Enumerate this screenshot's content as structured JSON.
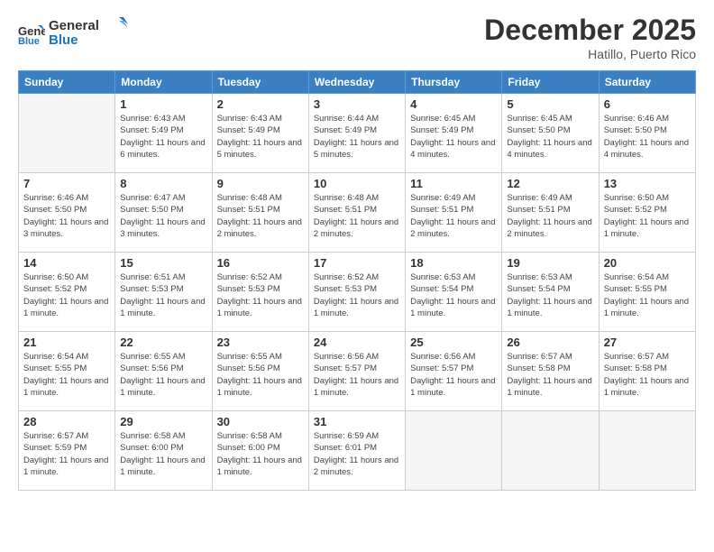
{
  "header": {
    "logo_line1": "General",
    "logo_line2": "Blue",
    "month_title": "December 2025",
    "location": "Hatillo, Puerto Rico"
  },
  "days_of_week": [
    "Sunday",
    "Monday",
    "Tuesday",
    "Wednesday",
    "Thursday",
    "Friday",
    "Saturday"
  ],
  "weeks": [
    [
      {
        "day": "",
        "info": ""
      },
      {
        "day": "1",
        "info": "Sunrise: 6:43 AM\nSunset: 5:49 PM\nDaylight: 11 hours\nand 6 minutes."
      },
      {
        "day": "2",
        "info": "Sunrise: 6:43 AM\nSunset: 5:49 PM\nDaylight: 11 hours\nand 5 minutes."
      },
      {
        "day": "3",
        "info": "Sunrise: 6:44 AM\nSunset: 5:49 PM\nDaylight: 11 hours\nand 5 minutes."
      },
      {
        "day": "4",
        "info": "Sunrise: 6:45 AM\nSunset: 5:49 PM\nDaylight: 11 hours\nand 4 minutes."
      },
      {
        "day": "5",
        "info": "Sunrise: 6:45 AM\nSunset: 5:50 PM\nDaylight: 11 hours\nand 4 minutes."
      },
      {
        "day": "6",
        "info": "Sunrise: 6:46 AM\nSunset: 5:50 PM\nDaylight: 11 hours\nand 4 minutes."
      }
    ],
    [
      {
        "day": "7",
        "info": "Sunrise: 6:46 AM\nSunset: 5:50 PM\nDaylight: 11 hours\nand 3 minutes."
      },
      {
        "day": "8",
        "info": "Sunrise: 6:47 AM\nSunset: 5:50 PM\nDaylight: 11 hours\nand 3 minutes."
      },
      {
        "day": "9",
        "info": "Sunrise: 6:48 AM\nSunset: 5:51 PM\nDaylight: 11 hours\nand 2 minutes."
      },
      {
        "day": "10",
        "info": "Sunrise: 6:48 AM\nSunset: 5:51 PM\nDaylight: 11 hours\nand 2 minutes."
      },
      {
        "day": "11",
        "info": "Sunrise: 6:49 AM\nSunset: 5:51 PM\nDaylight: 11 hours\nand 2 minutes."
      },
      {
        "day": "12",
        "info": "Sunrise: 6:49 AM\nSunset: 5:51 PM\nDaylight: 11 hours\nand 2 minutes."
      },
      {
        "day": "13",
        "info": "Sunrise: 6:50 AM\nSunset: 5:52 PM\nDaylight: 11 hours\nand 1 minute."
      }
    ],
    [
      {
        "day": "14",
        "info": "Sunrise: 6:50 AM\nSunset: 5:52 PM\nDaylight: 11 hours\nand 1 minute."
      },
      {
        "day": "15",
        "info": "Sunrise: 6:51 AM\nSunset: 5:53 PM\nDaylight: 11 hours\nand 1 minute."
      },
      {
        "day": "16",
        "info": "Sunrise: 6:52 AM\nSunset: 5:53 PM\nDaylight: 11 hours\nand 1 minute."
      },
      {
        "day": "17",
        "info": "Sunrise: 6:52 AM\nSunset: 5:53 PM\nDaylight: 11 hours\nand 1 minute."
      },
      {
        "day": "18",
        "info": "Sunrise: 6:53 AM\nSunset: 5:54 PM\nDaylight: 11 hours\nand 1 minute."
      },
      {
        "day": "19",
        "info": "Sunrise: 6:53 AM\nSunset: 5:54 PM\nDaylight: 11 hours\nand 1 minute."
      },
      {
        "day": "20",
        "info": "Sunrise: 6:54 AM\nSunset: 5:55 PM\nDaylight: 11 hours\nand 1 minute."
      }
    ],
    [
      {
        "day": "21",
        "info": "Sunrise: 6:54 AM\nSunset: 5:55 PM\nDaylight: 11 hours\nand 1 minute."
      },
      {
        "day": "22",
        "info": "Sunrise: 6:55 AM\nSunset: 5:56 PM\nDaylight: 11 hours\nand 1 minute."
      },
      {
        "day": "23",
        "info": "Sunrise: 6:55 AM\nSunset: 5:56 PM\nDaylight: 11 hours\nand 1 minute."
      },
      {
        "day": "24",
        "info": "Sunrise: 6:56 AM\nSunset: 5:57 PM\nDaylight: 11 hours\nand 1 minute."
      },
      {
        "day": "25",
        "info": "Sunrise: 6:56 AM\nSunset: 5:57 PM\nDaylight: 11 hours\nand 1 minute."
      },
      {
        "day": "26",
        "info": "Sunrise: 6:57 AM\nSunset: 5:58 PM\nDaylight: 11 hours\nand 1 minute."
      },
      {
        "day": "27",
        "info": "Sunrise: 6:57 AM\nSunset: 5:58 PM\nDaylight: 11 hours\nand 1 minute."
      }
    ],
    [
      {
        "day": "28",
        "info": "Sunrise: 6:57 AM\nSunset: 5:59 PM\nDaylight: 11 hours\nand 1 minute."
      },
      {
        "day": "29",
        "info": "Sunrise: 6:58 AM\nSunset: 6:00 PM\nDaylight: 11 hours\nand 1 minute."
      },
      {
        "day": "30",
        "info": "Sunrise: 6:58 AM\nSunset: 6:00 PM\nDaylight: 11 hours\nand 1 minute."
      },
      {
        "day": "31",
        "info": "Sunrise: 6:59 AM\nSunset: 6:01 PM\nDaylight: 11 hours\nand 2 minutes."
      },
      {
        "day": "",
        "info": ""
      },
      {
        "day": "",
        "info": ""
      },
      {
        "day": "",
        "info": ""
      }
    ]
  ]
}
